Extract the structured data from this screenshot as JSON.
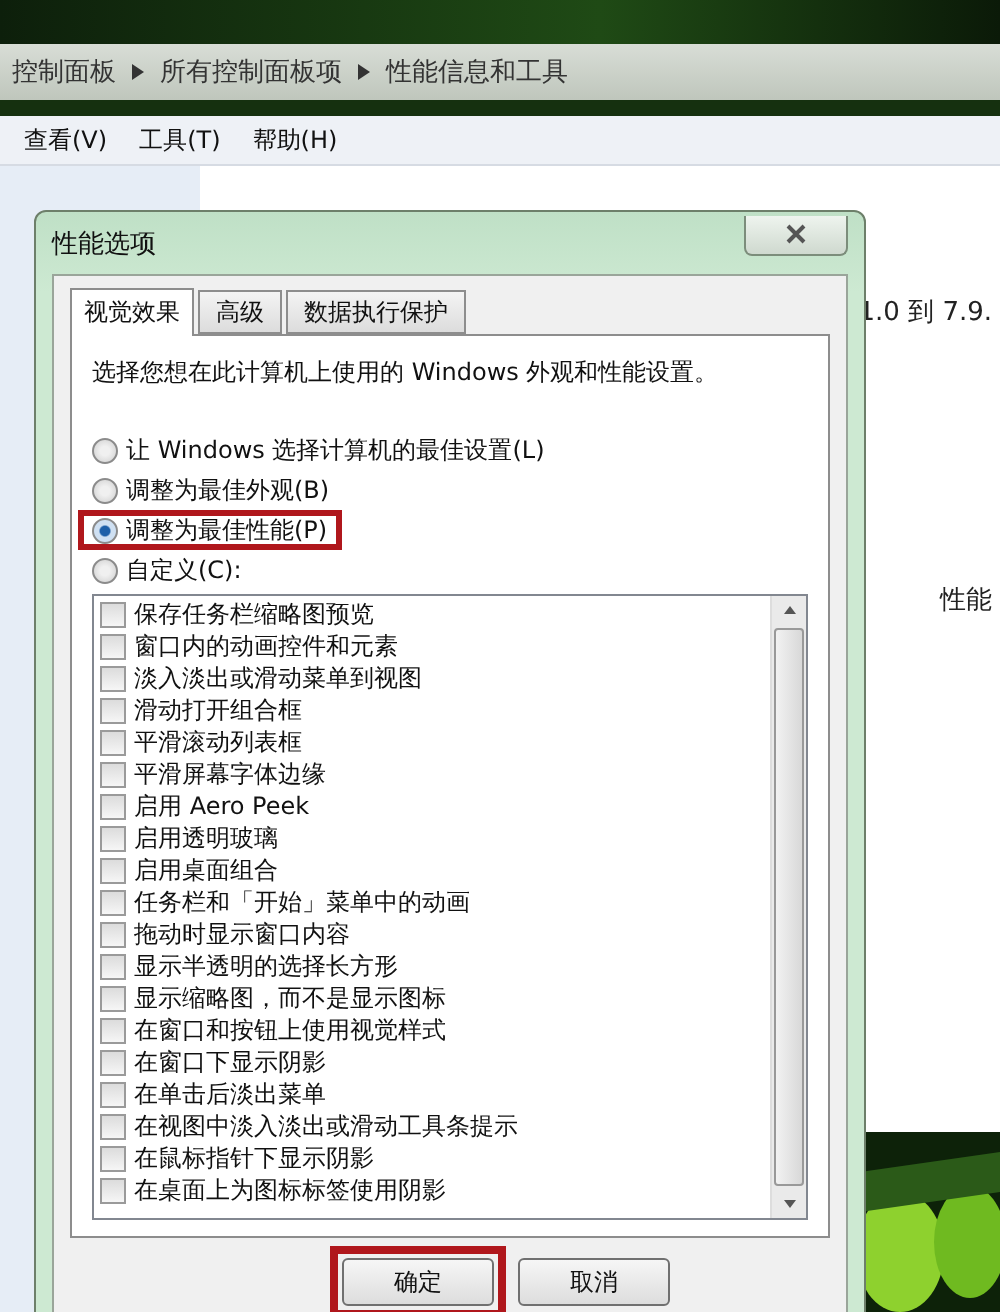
{
  "breadcrumb": [
    "控制面板",
    "所有控制面板项",
    "性能信息和工具"
  ],
  "menu": [
    "查看(V)",
    "工具(T)",
    "帮助(H)"
  ],
  "background_texts": [
    "1.0 到 7.9.",
    "性能"
  ],
  "dialog": {
    "title": "性能选项",
    "tabs": [
      {
        "label": "视觉效果",
        "selected": true
      },
      {
        "label": "高级",
        "selected": false
      },
      {
        "label": "数据执行保护",
        "selected": false
      }
    ],
    "description": "选择您想在此计算机上使用的 Windows 外观和性能设置。",
    "options": [
      {
        "label": "让 Windows 选择计算机的最佳设置(L)",
        "selected": false,
        "highlighted": false
      },
      {
        "label": "调整为最佳外观(B)",
        "selected": false,
        "highlighted": false
      },
      {
        "label": "调整为最佳性能(P)",
        "selected": true,
        "highlighted": true
      },
      {
        "label": "自定义(C):",
        "selected": false,
        "highlighted": false
      }
    ],
    "effects": [
      {
        "label": "保存任务栏缩略图预览",
        "checked": false
      },
      {
        "label": "窗口内的动画控件和元素",
        "checked": false
      },
      {
        "label": "淡入淡出或滑动菜单到视图",
        "checked": false
      },
      {
        "label": "滑动打开组合框",
        "checked": false
      },
      {
        "label": "平滑滚动列表框",
        "checked": false
      },
      {
        "label": "平滑屏幕字体边缘",
        "checked": false
      },
      {
        "label": "启用 Aero Peek",
        "checked": false
      },
      {
        "label": "启用透明玻璃",
        "checked": false
      },
      {
        "label": "启用桌面组合",
        "checked": false
      },
      {
        "label": "任务栏和「开始」菜单中的动画",
        "checked": false
      },
      {
        "label": "拖动时显示窗口内容",
        "checked": false
      },
      {
        "label": "显示半透明的选择长方形",
        "checked": false
      },
      {
        "label": "显示缩略图，而不是显示图标",
        "checked": false
      },
      {
        "label": "在窗口和按钮上使用视觉样式",
        "checked": false
      },
      {
        "label": "在窗口下显示阴影",
        "checked": false
      },
      {
        "label": "在单击后淡出菜单",
        "checked": false
      },
      {
        "label": "在视图中淡入淡出或滑动工具条提示",
        "checked": false
      },
      {
        "label": "在鼠标指针下显示阴影",
        "checked": false
      },
      {
        "label": "在桌面上为图标标签使用阴影",
        "checked": false
      }
    ],
    "buttons": [
      {
        "label": "确定",
        "highlighted": true
      },
      {
        "label": "取消",
        "highlighted": false
      }
    ]
  }
}
